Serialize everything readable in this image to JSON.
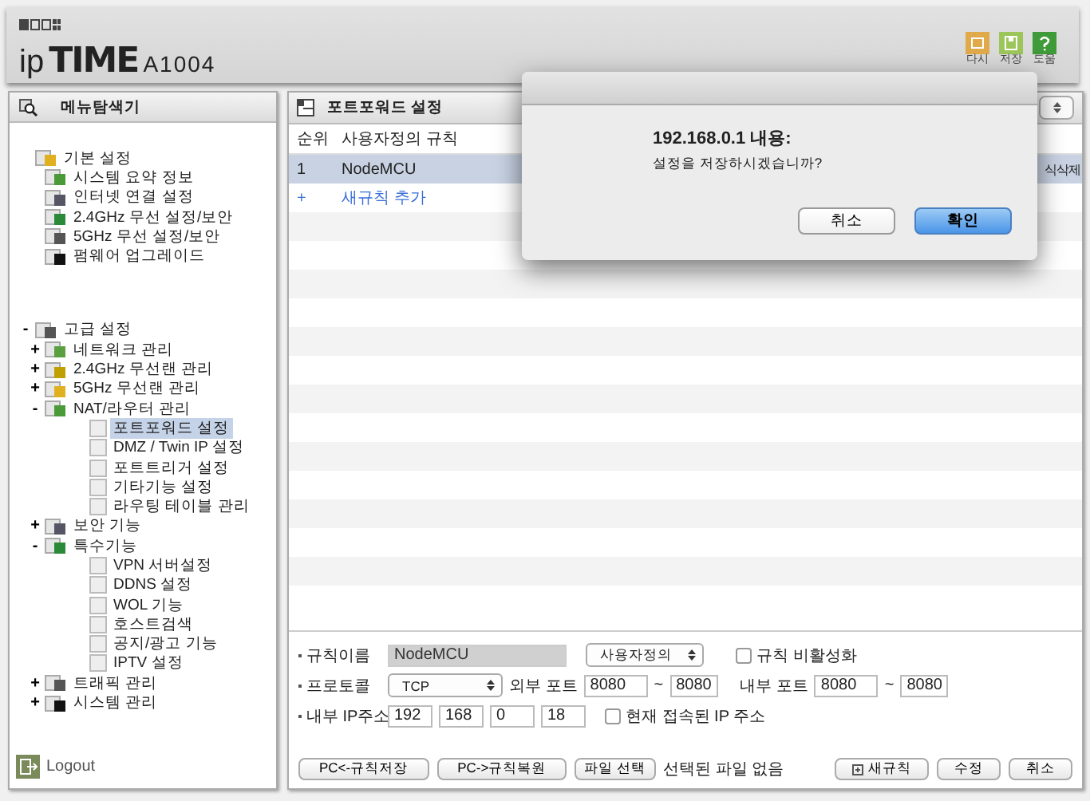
{
  "header": {
    "logo_prefix": "ip",
    "logo_brand": "TIME",
    "model": "A1004",
    "actions": [
      {
        "label": "다시"
      },
      {
        "label": "저장"
      },
      {
        "label": "도움"
      }
    ]
  },
  "sidebar": {
    "title": "메뉴탐색기",
    "tree": [
      {
        "label": "기본 설정",
        "selected": false,
        "children": [
          {
            "label": "시스템 요약 정보",
            "selected": false
          },
          {
            "label": "인터넷 연결 설정",
            "selected": false
          },
          {
            "label": "2.4GHz 무선 설정/보안",
            "selected": false
          },
          {
            "label": "5GHz 무선 설정/보안",
            "selected": false
          },
          {
            "label": "펌웨어 업그레이드",
            "selected": false
          }
        ]
      },
      {
        "label": "고급 설정",
        "toggle": "-",
        "selected": false,
        "children": [
          {
            "label": "네트워크 관리",
            "toggle": "+",
            "selected": false
          },
          {
            "label": "2.4GHz 무선랜 관리",
            "toggle": "+",
            "selected": false
          },
          {
            "label": "5GHz 무선랜 관리",
            "toggle": "+",
            "selected": false
          },
          {
            "label": "NAT/라우터 관리",
            "toggle": "-",
            "selected": false,
            "children": [
              {
                "label": "포트포워드 설정",
                "selected": true
              },
              {
                "label": "DMZ / Twin IP 설정",
                "selected": false
              },
              {
                "label": "포트트리거 설정",
                "selected": false
              },
              {
                "label": "기타기능 설정",
                "selected": false
              },
              {
                "label": "라우팅 테이블 관리",
                "selected": false
              }
            ]
          },
          {
            "label": "보안 기능",
            "toggle": "+",
            "selected": false
          },
          {
            "label": "특수기능",
            "toggle": "-",
            "selected": false,
            "children": [
              {
                "label": "VPN 서버설정",
                "selected": false
              },
              {
                "label": "DDNS 설정",
                "selected": false
              },
              {
                "label": "WOL 기능",
                "selected": false
              },
              {
                "label": "호스트검색",
                "selected": false
              },
              {
                "label": "공지/광고 기능",
                "selected": false
              },
              {
                "label": "IPTV 설정",
                "selected": false
              }
            ]
          },
          {
            "label": "트래픽 관리",
            "toggle": "+",
            "selected": false
          },
          {
            "label": "시스템 관리",
            "toggle": "+",
            "selected": false
          }
        ]
      }
    ],
    "logout": "Logout"
  },
  "panel": {
    "title": "포트포워드 설정",
    "columns": [
      "순위",
      "사용자정의 규칙"
    ],
    "rows": [
      {
        "kind": "rule",
        "rank": "1",
        "name": "NodeMCU",
        "action": "식삭제",
        "selected": true
      },
      {
        "kind": "add",
        "rank": "+",
        "name": "새규칙 추가",
        "selected": false
      }
    ],
    "form": {
      "rule_name": {
        "label": "규칙이름",
        "value": "NodeMCU",
        "type_select": "사용자정의",
        "disable": {
          "label": "규칙 비활성화",
          "checked": false
        }
      },
      "protocol": {
        "label": "프로토콜",
        "value": "TCP",
        "external_label": "외부 포트",
        "external_from": "8080",
        "external_to": "8080",
        "internal_label": "내부 포트",
        "internal_from": "8080",
        "internal_to": "8080",
        "separator": "~"
      },
      "internal_ip": {
        "label": "내부 IP주소",
        "octets": [
          "192",
          "168",
          "0",
          "18"
        ],
        "current_ip": {
          "label": "현재 접속된 IP 주소",
          "checked": false
        }
      }
    },
    "footer": {
      "left_buttons": [
        "PC<-규칙저장",
        "PC->규칙복원"
      ],
      "file_button": "파일 선택",
      "file_status": "선택된 파일 없음",
      "right_buttons": [
        {
          "kind": "new",
          "label": "새규칙"
        },
        {
          "kind": "plain",
          "label": "수정"
        },
        {
          "kind": "plain",
          "label": "취소"
        }
      ]
    }
  },
  "dialog": {
    "title": "192.168.0.1 내용:",
    "message": "설정을 저장하시겠습니까?",
    "buttons": [
      {
        "label": "취소",
        "default": false
      },
      {
        "label": "확인",
        "default": true
      }
    ]
  }
}
